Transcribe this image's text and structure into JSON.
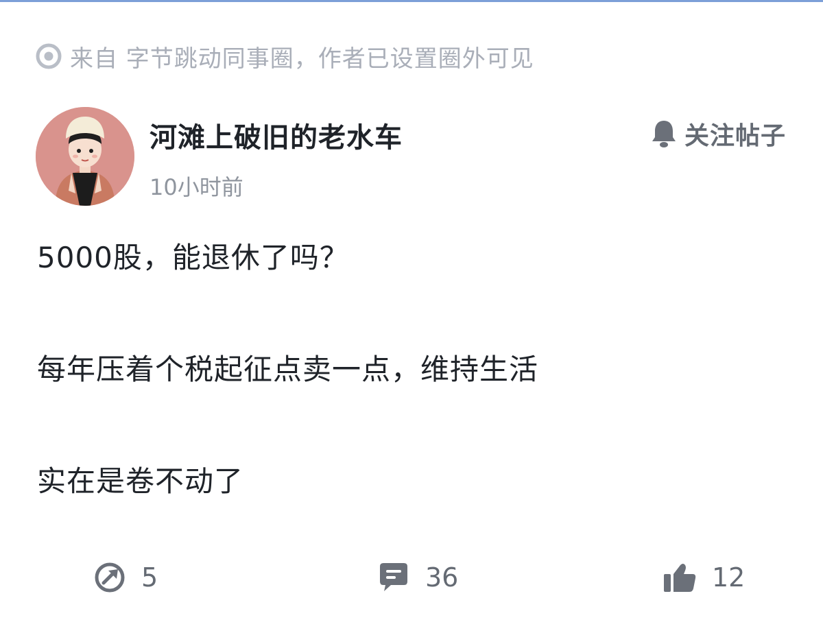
{
  "source": {
    "icon": "circle-dot-icon",
    "text": "来自 字节跳动同事圈，作者已设置圈外可见"
  },
  "author": {
    "avatar_icon": "cartoon-avatar",
    "name": "河滩上破旧的老水车",
    "time": "10小时前"
  },
  "follow": {
    "icon": "bell-icon",
    "label": "关注帖子"
  },
  "post": {
    "lines": [
      "5000股，能退休了吗？",
      "每年压着个税起征点卖一点，维持生活",
      "实在是卷不动了"
    ]
  },
  "actions": {
    "share": {
      "icon": "share-icon",
      "count": "5"
    },
    "comment": {
      "icon": "comment-icon",
      "count": "36"
    },
    "like": {
      "icon": "thumbs-up-icon",
      "count": "12"
    }
  },
  "colors": {
    "accent_rule": "#7c9fd8",
    "muted_text": "#a9aeb8",
    "icon_gray": "#646a73",
    "avatar_bg": "#d9938d"
  }
}
